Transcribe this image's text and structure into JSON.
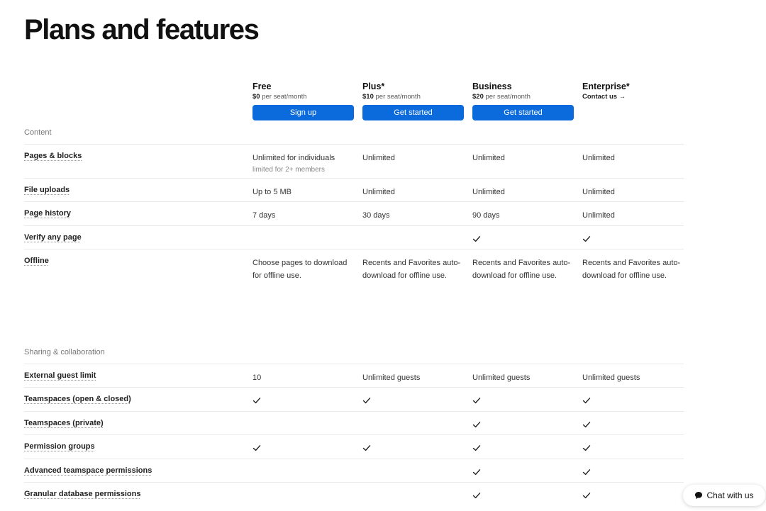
{
  "page_title": "Plans and features",
  "plans": [
    {
      "name": "Free",
      "price": "$0",
      "unit": " per seat/month",
      "button": "Sign up"
    },
    {
      "name": "Plus*",
      "price": "$10",
      "unit": " per seat/month",
      "button": "Get started"
    },
    {
      "name": "Business",
      "price": "$20",
      "unit": " per seat/month",
      "button": "Get started"
    },
    {
      "name": "Enterprise*",
      "contact": "Contact us →"
    }
  ],
  "sections": [
    {
      "label": "Content",
      "rows": [
        {
          "feature": "Pages & blocks",
          "values": [
            "Unlimited for individuals",
            "Unlimited",
            "Unlimited",
            "Unlimited"
          ],
          "free_sub": "limited for 2+ members"
        },
        {
          "feature": "File uploads",
          "values": [
            "Up to 5 MB",
            "Unlimited",
            "Unlimited",
            "Unlimited"
          ]
        },
        {
          "feature": "Page history",
          "values": [
            "7 days",
            "30 days",
            "90 days",
            "Unlimited"
          ]
        },
        {
          "feature": "Verify any page",
          "checks": [
            false,
            false,
            true,
            true
          ]
        },
        {
          "feature": "Offline",
          "values": [
            "Choose pages to download for offline use.",
            "Recents and Favorites auto-download for offline use.",
            "Recents and Favorites auto-download for offline use.",
            "Recents and Favorites auto-download for offline use."
          ]
        }
      ]
    },
    {
      "label": "Sharing & collaboration",
      "rows": [
        {
          "feature": "External guest limit",
          "values": [
            "10",
            "Unlimited guests",
            "Unlimited guests",
            "Unlimited guests"
          ]
        },
        {
          "feature": "Teamspaces (open & closed)",
          "checks": [
            true,
            true,
            true,
            true
          ]
        },
        {
          "feature": "Teamspaces (private)",
          "checks": [
            false,
            false,
            true,
            true
          ]
        },
        {
          "feature": "Permission groups",
          "checks": [
            true,
            true,
            true,
            true
          ]
        },
        {
          "feature": "Advanced teamspace permissions",
          "checks": [
            false,
            false,
            true,
            true
          ]
        },
        {
          "feature": "Granular database permissions",
          "checks": [
            false,
            false,
            true,
            true
          ]
        }
      ]
    }
  ],
  "chat": {
    "label": "Chat with us"
  },
  "icons": {
    "check": "check-icon",
    "chat": "chat-bubble-icon"
  },
  "colors": {
    "accent": "#0b6bdc"
  }
}
